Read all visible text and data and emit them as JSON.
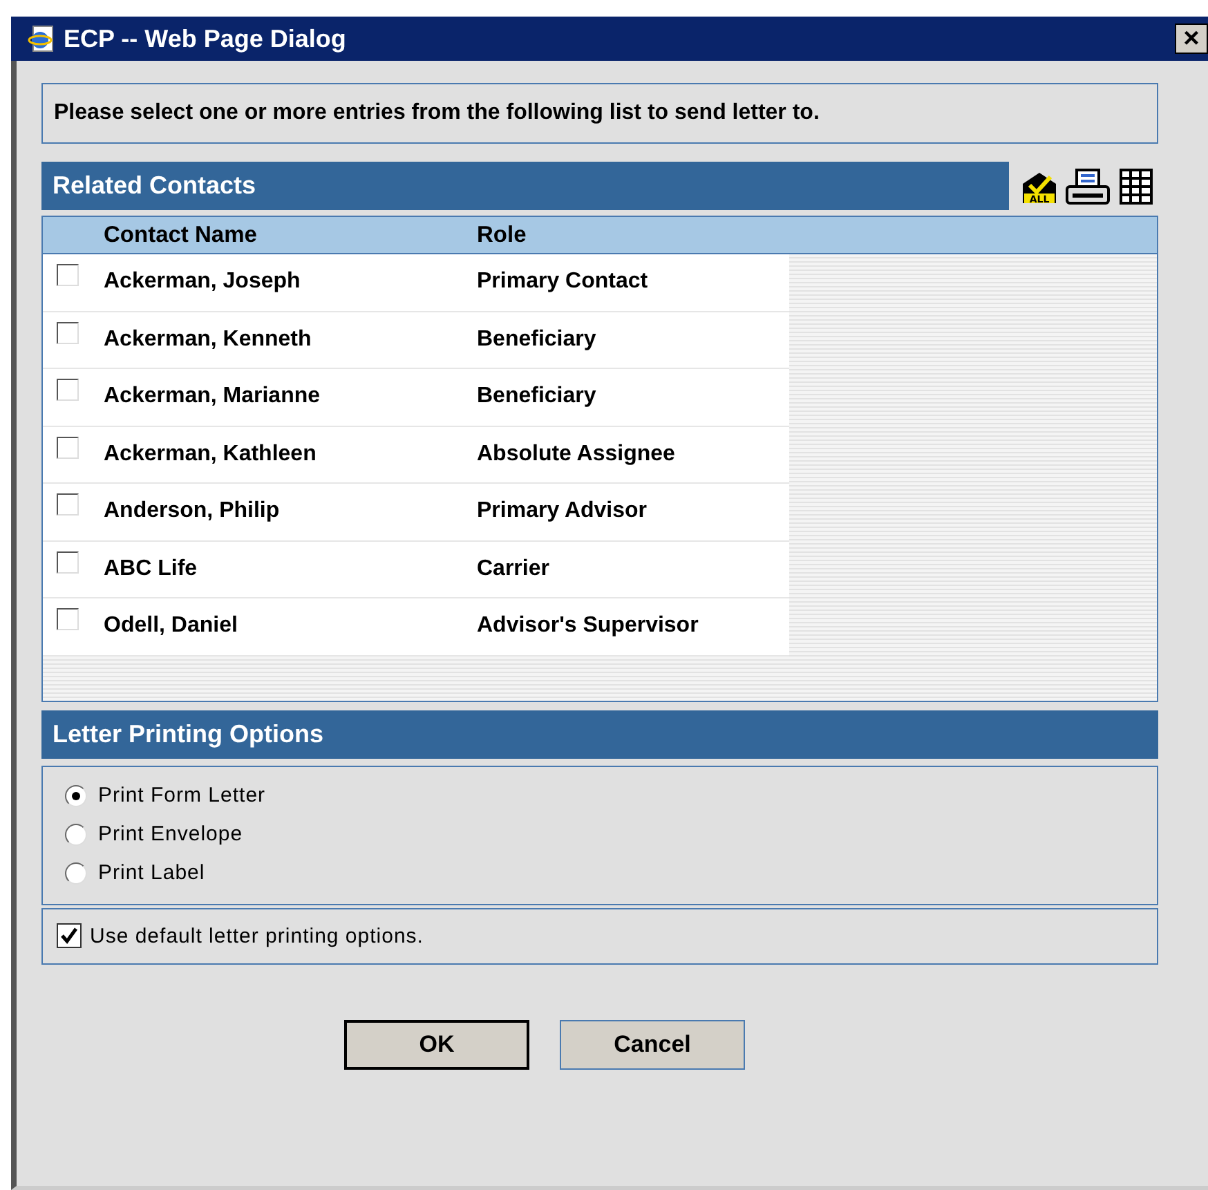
{
  "window": {
    "title": "ECP -- Web Page Dialog",
    "close": "×"
  },
  "instruction": "Please select one or more entries from the following list to send letter to.",
  "contacts": {
    "title": "Related Contacts",
    "select_all_label": "ALL",
    "columns": [
      "Contact Name",
      "Role"
    ],
    "rows": [
      {
        "name": "Ackerman, Joseph",
        "role": "Primary Contact",
        "checked": false
      },
      {
        "name": "Ackerman, Kenneth",
        "role": "Beneficiary",
        "checked": false
      },
      {
        "name": "Ackerman, Marianne",
        "role": "Beneficiary",
        "checked": false
      },
      {
        "name": "Ackerman, Kathleen",
        "role": "Absolute Assignee",
        "checked": false
      },
      {
        "name": "Anderson, Philip",
        "role": "Primary Advisor",
        "checked": false
      },
      {
        "name": "ABC Life",
        "role": "Carrier",
        "checked": false
      },
      {
        "name": "Odell, Daniel",
        "role": "Advisor's Supervisor",
        "checked": false
      }
    ]
  },
  "printing": {
    "title": "Letter Printing Options",
    "options": [
      {
        "label": "Print Form Letter",
        "selected": true
      },
      {
        "label": "Print Envelope",
        "selected": false
      },
      {
        "label": "Print Label",
        "selected": false
      }
    ],
    "use_default": {
      "label": "Use default letter printing options.",
      "checked": true
    }
  },
  "buttons": [
    {
      "label": "OK",
      "default": true
    },
    {
      "label": "Cancel",
      "default": false
    }
  ]
}
